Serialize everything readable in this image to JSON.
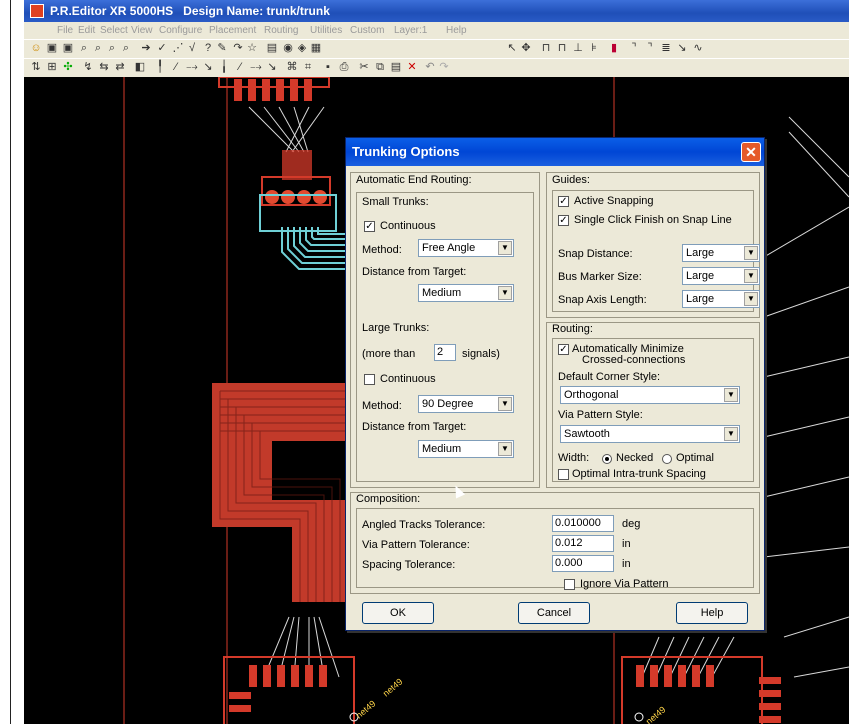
{
  "window": {
    "title_app": "P.R.Editor XR 5000HS",
    "title_design": "Design Name: trunk/trunk"
  },
  "menu": [
    "File",
    "Edit",
    "Select",
    "View",
    "Configure",
    "Placement",
    "Routing",
    "Utilities",
    "Custom",
    "Layer:1",
    "Help"
  ],
  "canvas_labels": [
    "net49",
    "net49",
    "net49"
  ],
  "colors": {
    "copper": "#d43a2a",
    "trace_cyan": "#6fd0d6",
    "board_line": "#d43a2a",
    "canvas_bg": "#000000"
  },
  "dialog": {
    "title": "Trunking Options",
    "close_icon": "close-icon",
    "automatic_end_routing": {
      "heading": "Automatic End Routing:",
      "small_trunks": {
        "heading": "Small Trunks:",
        "continuous_label": "Continuous",
        "continuous_checked": true,
        "method_label": "Method:",
        "method_value": "Free Angle",
        "distance_label": "Distance from Target:",
        "distance_value": "Medium"
      },
      "large_trunks": {
        "heading": "Large Trunks:",
        "more_than_label": "(more than",
        "more_than_value": "2",
        "signals_label": "signals)",
        "continuous_label": "Continuous",
        "continuous_checked": false,
        "method_label": "Method:",
        "method_value": "90 Degree",
        "distance_label": "Distance from Target:",
        "distance_value": "Medium"
      }
    },
    "guides": {
      "heading": "Guides:",
      "active_snapping_label": "Active Snapping",
      "active_snapping_checked": true,
      "single_click_label": "Single Click Finish on Snap Line",
      "single_click_checked": true,
      "snap_distance_label": "Snap Distance:",
      "snap_distance_value": "Large",
      "bus_marker_label": "Bus Marker Size:",
      "bus_marker_value": "Large",
      "snap_axis_label": "Snap Axis Length:",
      "snap_axis_value": "Large"
    },
    "routing": {
      "heading": "Routing:",
      "auto_minimize_label_1": "Automatically Minimize",
      "auto_minimize_label_2": "Crossed-connections",
      "auto_minimize_checked": true,
      "corner_style_label": "Default Corner Style:",
      "corner_style_value": "Orthogonal",
      "via_pattern_label": "Via Pattern Style:",
      "via_pattern_value": "Sawtooth",
      "width_label": "Width:",
      "necked_label": "Necked",
      "optimal_label": "Optimal",
      "width_selected": "Necked",
      "intra_trunk_label": "Optimal Intra-trunk Spacing",
      "intra_trunk_checked": false
    },
    "composition": {
      "heading": "Composition:",
      "angled_label": "Angled Tracks Tolerance:",
      "angled_value": "0.010000",
      "angled_unit": "deg",
      "via_label": "Via Pattern Tolerance:",
      "via_value": "0.012",
      "via_unit": "in",
      "spacing_label": "Spacing Tolerance:",
      "spacing_value": "0.000",
      "spacing_unit": "in",
      "ignore_via_label": "Ignore Via Pattern",
      "ignore_via_checked": false
    },
    "buttons": {
      "ok": "OK",
      "cancel": "Cancel",
      "help": "Help"
    }
  }
}
